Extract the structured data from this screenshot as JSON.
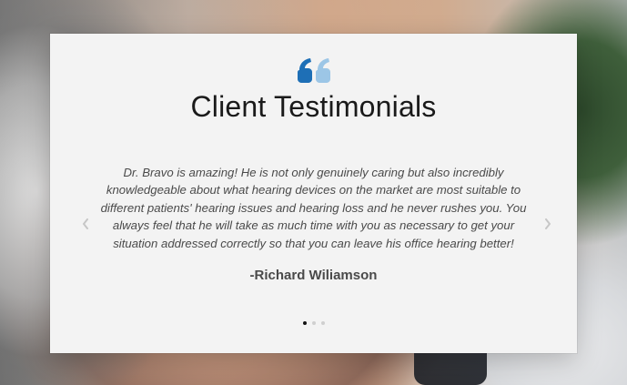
{
  "section": {
    "title": "Client Testimonials"
  },
  "testimonial": {
    "text": "Dr. Bravo is amazing! He is not only genuinely caring but also incredibly knowledgeable about what hearing devices on the market are most suitable to different patients' hearing issues and hearing loss and he never rushes you. You always feel that he will take as much time with you as necessary to get your situation addressed correctly so that you can leave his office hearing better!",
    "author": "-Richard Wiliamson"
  },
  "icons": {
    "quote": "quote-icon",
    "prev": "chevron-left-icon",
    "next": "chevron-right-icon"
  },
  "carousel": {
    "slides": 3,
    "active_index": 0
  },
  "colors": {
    "quote_primary": "#1e6fb6",
    "quote_secondary": "#9cc6e6",
    "card_bg": "#f3f3f3",
    "title": "#1a1a1a",
    "body_text": "#4a4a4a",
    "dot_active": "#111111",
    "dot_inactive": "#cfcfcf"
  }
}
